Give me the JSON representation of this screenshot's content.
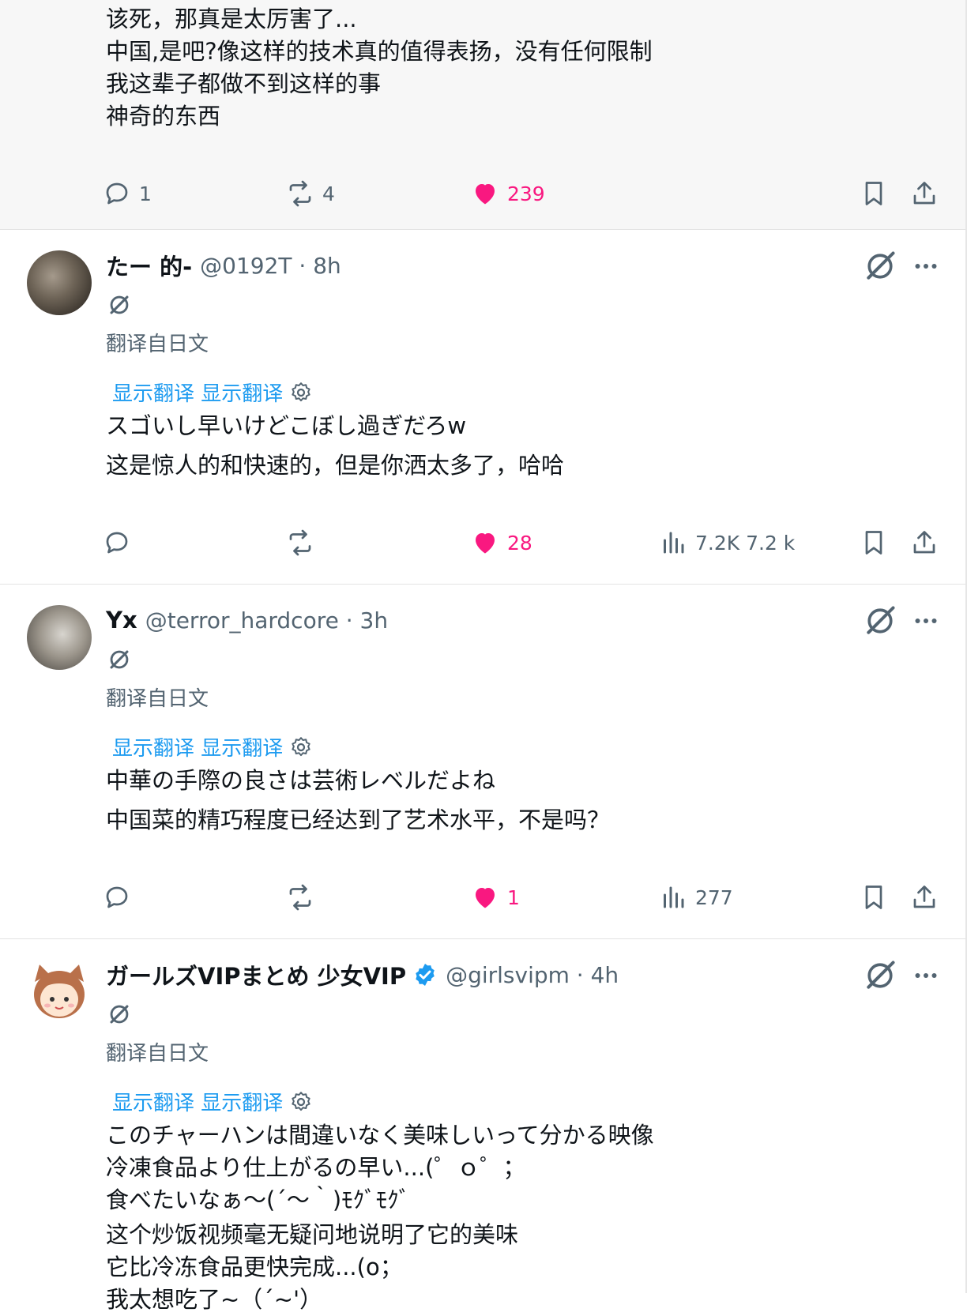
{
  "top_tweet": {
    "lines": [
      "该死，那真是太厉害了...",
      "中国,是吧?像这样的技术真的值得表扬，没有任何限制",
      "我这辈子都做不到这样的事",
      "神奇的东西"
    ],
    "reply_count": "1",
    "repost_count": "4",
    "like_count": "239"
  },
  "replies": [
    {
      "name": "たー 的-",
      "handle": "@0192T · 8h",
      "translated_from": "翻译自日文",
      "show_translation": "显示翻译 显示翻译",
      "original": [
        "スゴいし早いけどこぼし過ぎだろw"
      ],
      "translation": [
        "这是惊人的和快速的，但是你洒太多了，哈哈"
      ],
      "like_count": "28",
      "views": "7.2K 7.2 k"
    },
    {
      "name": "Yx",
      "handle": "@terror_hardcore · 3h",
      "translated_from": "翻译自日文",
      "show_translation": "显示翻译 显示翻译",
      "original": [
        "中華の手際の良さは芸術レベルだよね"
      ],
      "translation": [
        "中国菜的精巧程度已经达到了艺术水平，不是吗？"
      ],
      "like_count": "1",
      "views": "277"
    },
    {
      "name": "ガールズVIPまとめ 少女VIP",
      "handle": "@girlsvipm · 4h",
      "translated_from": "翻译自日文",
      "show_translation": "显示翻译 显示翻译",
      "original": [
        "このチャーハンは間違いなく美味しいって分かる映像",
        "冷凍食品より仕上がるの早い...(゜ｏ゜；",
        "食べたいなぁ〜(´〜｀)ﾓｸﾞﾓｸﾞ"
      ],
      "translation": [
        "这个炒饭视频毫无疑问地说明了它的美味",
        "它比冷冻食品更快完成...(o；",
        "我太想吃了~（´~'）"
      ]
    }
  ],
  "colors": {
    "accent": "#1d9bf0",
    "like": "#f91880",
    "muted": "#536471"
  }
}
